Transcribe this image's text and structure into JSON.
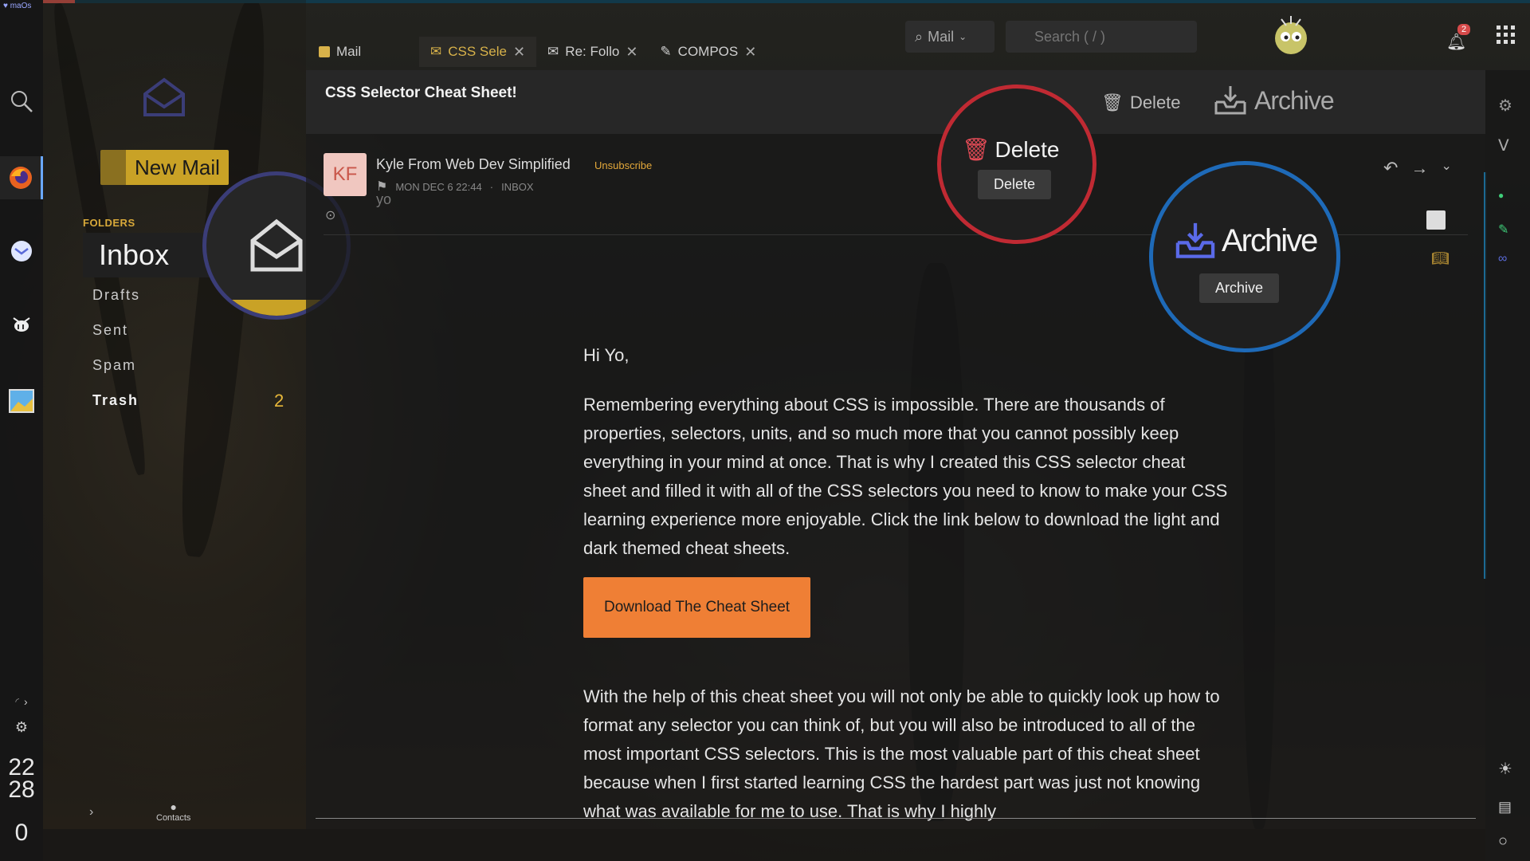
{
  "os": {
    "brand": "maOs",
    "clock_hour": "22",
    "clock_min": "28",
    "counter": "0"
  },
  "folders": {
    "new_mail": "New Mail",
    "heading": "FOLDERS",
    "items": [
      {
        "label": "Inbox"
      },
      {
        "label": "Drafts"
      },
      {
        "label": "Sent"
      },
      {
        "label": "Spam"
      },
      {
        "label": "Trash",
        "count": "2"
      }
    ],
    "contacts": "Contacts"
  },
  "tabs": [
    {
      "label": "Mail"
    },
    {
      "label": "CSS Sele"
    },
    {
      "label": "Re: Follo"
    },
    {
      "label": "COMPOS"
    }
  ],
  "topbar": {
    "mail_select": "Mail",
    "search_placeholder": "Search ( / )",
    "notifications": "2"
  },
  "email": {
    "subject": "CSS Selector Cheat Sheet!",
    "toolbar": {
      "delete": "Delete",
      "archive": "Archive"
    },
    "avatar_initials": "KF",
    "sender": "Kyle From Web Dev Simplified",
    "unsubscribe": "Unsubscribe",
    "date": "MON DEC 6 22:44",
    "folder": "INBOX",
    "preview": "yo",
    "greeting": "Hi Yo,",
    "paragraph1": "Remembering everything about CSS is impossible. There are thousands of properties, selectors, units, and so much more that you cannot possibly keep everything in your mind at once. That is why I created this CSS selector cheat sheet and filled it with all of the CSS selectors you need to know to make your CSS learning experience more enjoyable. Click the link below to download the light and dark themed cheat sheets.",
    "cta": "Download The Cheat Sheet",
    "paragraph2": "With the help of this cheat sheet you will not only be able to quickly look up how to format any selector you can think of, but you will also be introduced to all of the most important CSS selectors. This is the most valuable part of this cheat sheet because when I first started learning CSS the hardest part was just not knowing what was available for me to use. That is why I highly"
  },
  "callouts": {
    "delete_big": "Delete",
    "delete_tooltip": "Delete",
    "archive_big": "Archive",
    "archive_tooltip": "Archive"
  },
  "colors": {
    "accent": "#d8b24a",
    "cta": "#ef7f35",
    "delete_ring": "#c02a33",
    "archive_ring": "#1e6ab8",
    "inbox_ring": "#3b3d78"
  }
}
